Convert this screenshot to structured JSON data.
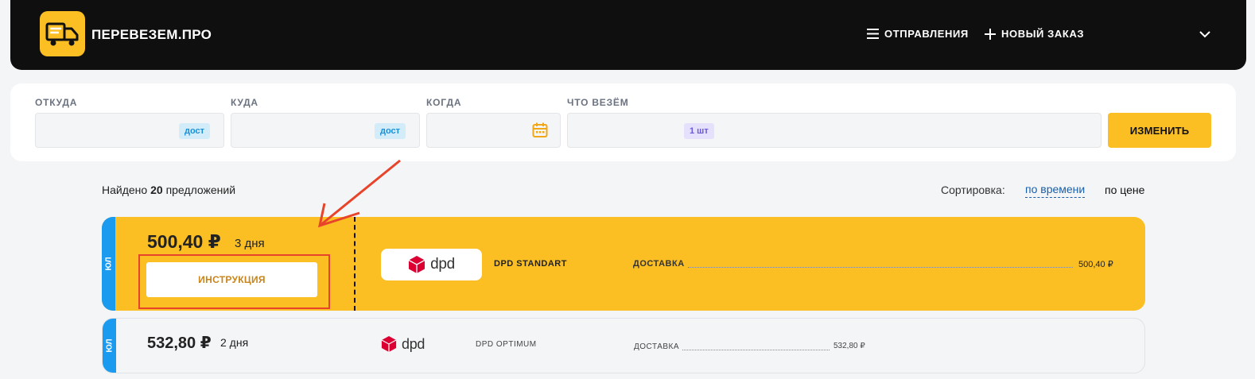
{
  "header": {
    "brand": "ПЕРЕВЕЗЕМ.ПРО",
    "nav_shipments": "ОТПРАВЛЕНИЯ",
    "nav_new_order": "НОВЫЙ ЗАКАЗ"
  },
  "search": {
    "from_label": "ОТКУДА",
    "from_tag": "дост",
    "to_label": "КУДА",
    "to_tag": "дост",
    "when_label": "КОГДА",
    "what_label": "ЧТО ВЕЗЁМ",
    "what_tag": "1 шт",
    "change_button": "ИЗМЕНИТЬ"
  },
  "results": {
    "found_prefix": "Найдено",
    "found_count": "20",
    "found_suffix": "предложений",
    "sort_label": "Сортировка:",
    "sort_time": "по времени",
    "sort_price": "по цене"
  },
  "offers": [
    {
      "strip": "ЮЛ",
      "price": "500,40 ₽",
      "days": "3 дня",
      "instruction": "ИНСТРУКЦИЯ",
      "carrier": "dpd",
      "service": "DPD STANDART",
      "delivery_label": "ДОСТАВКА",
      "delivery_amount": "500,40 ₽"
    },
    {
      "strip": "ЮЛ",
      "price": "532,80 ₽",
      "days": "2 дня",
      "carrier": "dpd",
      "service": "DPD OPTIMUM",
      "delivery_label": "ДОСТАВКА",
      "delivery_amount": "532,80 ₽"
    }
  ],
  "colors": {
    "accent": "#fbbf24",
    "header_bg": "#0f0f10",
    "strip_blue": "#1a9bf0",
    "annotation_red": "#e8442b",
    "dpd_red": "#dc0032"
  },
  "icons": [
    "truck-logo-icon",
    "menu-icon",
    "plus-icon",
    "chevron-down-icon",
    "calendar-icon",
    "dpd-cube-icon",
    "annotation-arrow-icon"
  ]
}
